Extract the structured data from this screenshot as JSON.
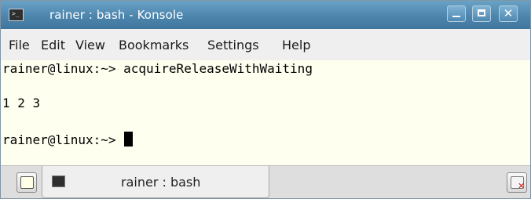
{
  "window": {
    "title": "rainer : bash - Konsole",
    "icon": "terminal-icon",
    "controls": {
      "minimize": "minimize-icon",
      "maximize": "maximize-icon",
      "close": "close-icon",
      "close_glyph": "✕"
    }
  },
  "menu": [
    "File",
    "Edit",
    "View",
    "Bookmarks",
    "Settings",
    "Help"
  ],
  "terminal": {
    "background": "#fffff0",
    "lines": [
      "rainer@linux:~> acquireReleaseWithWaiting",
      "",
      "1 2 3",
      "",
      "rainer@linux:~> "
    ]
  },
  "tabbar": {
    "new_tab_icon": "new-tab-icon",
    "tabs": [
      {
        "label": "rainer : bash",
        "icon": "terminal-icon",
        "active": true
      }
    ],
    "close_tab_icon": "close-tab-icon"
  },
  "colors": {
    "titlebar": "#4d85ad",
    "menubar": "#efefef",
    "tabbar": "#dedede"
  }
}
